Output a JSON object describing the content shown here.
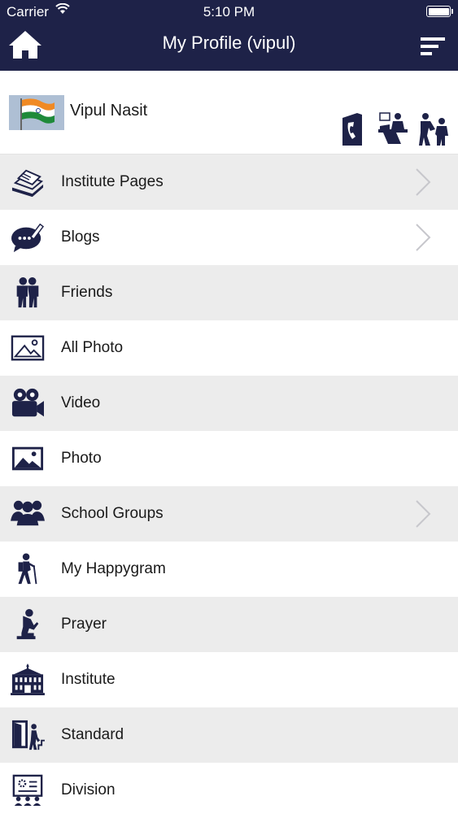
{
  "status_bar": {
    "carrier": "Carrier",
    "time": "5:10 PM"
  },
  "header": {
    "title": "My Profile (vipul)"
  },
  "profile": {
    "name": "Vipul Nasit"
  },
  "menu": [
    {
      "label": "Institute Pages",
      "icon": "pages-icon",
      "chevron": true
    },
    {
      "label": "Blogs",
      "icon": "chat-bubble-icon",
      "chevron": true
    },
    {
      "label": "Friends",
      "icon": "friends-icon",
      "chevron": false
    },
    {
      "label": "All Photo",
      "icon": "image-outline-icon",
      "chevron": false
    },
    {
      "label": "Video",
      "icon": "video-camera-icon",
      "chevron": false
    },
    {
      "label": "Photo",
      "icon": "image-icon",
      "chevron": false
    },
    {
      "label": "School Groups",
      "icon": "group-icon",
      "chevron": true
    },
    {
      "label": "My Happygram",
      "icon": "hiker-icon",
      "chevron": false
    },
    {
      "label": "Prayer",
      "icon": "prayer-icon",
      "chevron": false
    },
    {
      "label": "Institute",
      "icon": "institute-building-icon",
      "chevron": false
    },
    {
      "label": "Standard",
      "icon": "standard-door-icon",
      "chevron": false
    },
    {
      "label": "Division",
      "icon": "division-board-icon",
      "chevron": false
    }
  ],
  "colors": {
    "navbar": "#1e2248",
    "icon": "#1e2248",
    "row_alt": "#ececec"
  }
}
